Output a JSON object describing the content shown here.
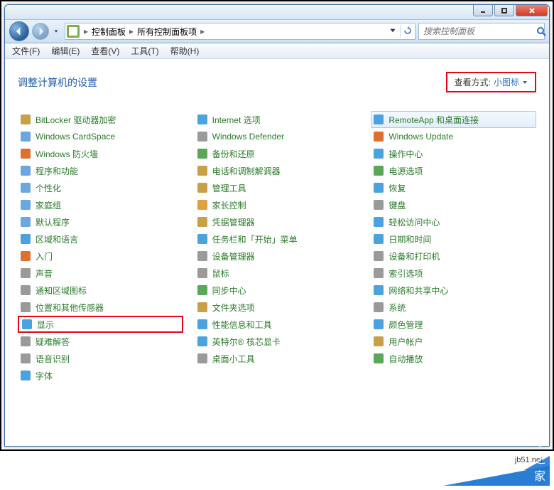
{
  "window": {
    "breadcrumb": [
      "控制面板",
      "所有控制面板项"
    ],
    "search_placeholder": "搜索控制面板"
  },
  "menu": [
    "文件(F)",
    "编辑(E)",
    "查看(V)",
    "工具(T)",
    "帮助(H)"
  ],
  "page_title": "调整计算机的设置",
  "view_mode": {
    "label": "查看方式:",
    "value": "小图标"
  },
  "columns": [
    [
      {
        "label": "BitLocker 驱动器加密",
        "icon": "#c8a048",
        "highlight": false
      },
      {
        "label": "Windows CardSpace",
        "icon": "#6aa6e0",
        "highlight": false
      },
      {
        "label": "Windows 防火墙",
        "icon": "#e07030",
        "highlight": false
      },
      {
        "label": "程序和功能",
        "icon": "#6aa6e0",
        "highlight": false
      },
      {
        "label": "个性化",
        "icon": "#6aa6e0",
        "highlight": false
      },
      {
        "label": "家庭组",
        "icon": "#6aa6e0",
        "highlight": false
      },
      {
        "label": "默认程序",
        "icon": "#6aa6e0",
        "highlight": false
      },
      {
        "label": "区域和语言",
        "icon": "#4aa3df",
        "highlight": false
      },
      {
        "label": "入门",
        "icon": "#e07030",
        "highlight": false
      },
      {
        "label": "声音",
        "icon": "#9a9a9a",
        "highlight": false
      },
      {
        "label": "通知区域图标",
        "icon": "#9a9a9a",
        "highlight": false
      },
      {
        "label": "位置和其他传感器",
        "icon": "#9a9a9a",
        "highlight": false
      },
      {
        "label": "显示",
        "icon": "#4aa3df",
        "highlight": true
      },
      {
        "label": "疑难解答",
        "icon": "#9a9a9a",
        "highlight": false
      },
      {
        "label": "语音识别",
        "icon": "#9a9a9a",
        "highlight": false
      },
      {
        "label": "字体",
        "icon": "#4aa3df",
        "highlight": false
      }
    ],
    [
      {
        "label": "Internet 选项",
        "icon": "#4aa3df",
        "highlight": false
      },
      {
        "label": "Windows Defender",
        "icon": "#9a9a9a",
        "highlight": false
      },
      {
        "label": "备份和还原",
        "icon": "#58a858",
        "highlight": false
      },
      {
        "label": "电话和调制解调器",
        "icon": "#c8a048",
        "highlight": false
      },
      {
        "label": "管理工具",
        "icon": "#c8a048",
        "highlight": false
      },
      {
        "label": "家长控制",
        "icon": "#e0a040",
        "highlight": false
      },
      {
        "label": "凭据管理器",
        "icon": "#c8a048",
        "highlight": false
      },
      {
        "label": "任务栏和「开始」菜单",
        "icon": "#4aa3df",
        "highlight": false
      },
      {
        "label": "设备管理器",
        "icon": "#9a9a9a",
        "highlight": false
      },
      {
        "label": "鼠标",
        "icon": "#9a9a9a",
        "highlight": false
      },
      {
        "label": "同步中心",
        "icon": "#58a858",
        "highlight": false
      },
      {
        "label": "文件夹选项",
        "icon": "#c8a048",
        "highlight": false
      },
      {
        "label": "性能信息和工具",
        "icon": "#4aa3df",
        "highlight": false
      },
      {
        "label": "英特尔® 核芯显卡",
        "icon": "#4aa3df",
        "highlight": false
      },
      {
        "label": "桌面小工具",
        "icon": "#9a9a9a",
        "highlight": false
      }
    ],
    [
      {
        "label": "RemoteApp 和桌面连接",
        "icon": "#4aa3df",
        "selected": true,
        "highlight": false
      },
      {
        "label": "Windows Update",
        "icon": "#e07030",
        "highlight": false
      },
      {
        "label": "操作中心",
        "icon": "#4aa3df",
        "highlight": false
      },
      {
        "label": "电源选项",
        "icon": "#58a858",
        "highlight": false
      },
      {
        "label": "恢复",
        "icon": "#4aa3df",
        "highlight": false
      },
      {
        "label": "键盘",
        "icon": "#9a9a9a",
        "highlight": false
      },
      {
        "label": "轻松访问中心",
        "icon": "#4aa3df",
        "highlight": false
      },
      {
        "label": "日期和时间",
        "icon": "#4aa3df",
        "highlight": false
      },
      {
        "label": "设备和打印机",
        "icon": "#9a9a9a",
        "highlight": false
      },
      {
        "label": "索引选项",
        "icon": "#9a9a9a",
        "highlight": false
      },
      {
        "label": "网络和共享中心",
        "icon": "#4aa3df",
        "highlight": false
      },
      {
        "label": "系统",
        "icon": "#9a9a9a",
        "highlight": false
      },
      {
        "label": "颜色管理",
        "icon": "#4aa3df",
        "highlight": false
      },
      {
        "label": "用户帐户",
        "icon": "#c8a048",
        "highlight": false
      },
      {
        "label": "自动播放",
        "icon": "#58a858",
        "highlight": false
      }
    ]
  ],
  "watermark": {
    "text": "脚本之家",
    "url": "jb51.net"
  }
}
